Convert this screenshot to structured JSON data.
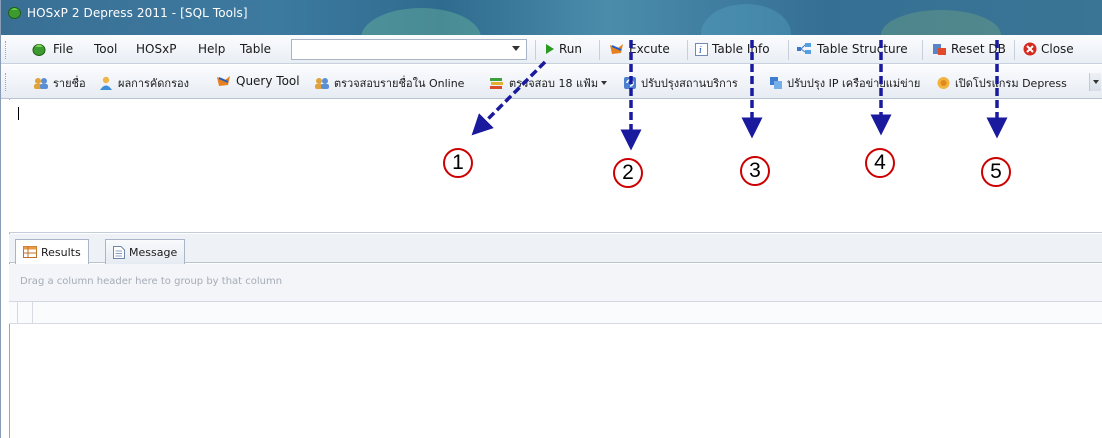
{
  "window": {
    "title": "HOSxP 2 Depress 2011 - [SQL Tools]"
  },
  "menu": {
    "items": [
      "File",
      "Tool",
      "HOSxP",
      "Help",
      "Table"
    ],
    "query_combo_value": "",
    "run": "Run",
    "excute": "Excute",
    "table_info": "Table Info",
    "table_structure": "Table Structure",
    "reset_db": "Reset DB",
    "close": "Close"
  },
  "shortcuts": {
    "items": [
      "รายชื่อ",
      "ผลการคัดกรอง",
      "Query Tool",
      "ตรวจสอบรายชื่อใน Online",
      "ตรวจสอบ 18 แฟ้ม",
      "ปรับปรุงสถานบริการ",
      "ปรับปรุง IP เครือข่ายแม่ข่าย",
      "เปิดโปรแกรม Depress"
    ]
  },
  "tabs": {
    "results": "Results",
    "message": "Message"
  },
  "grid": {
    "group_hint": "Drag a column header here to group by that column"
  },
  "annotations": {
    "labels": [
      "1",
      "2",
      "3",
      "4",
      "5"
    ],
    "arrow_color": "#1a1a9e",
    "circle_color": "#cc0000"
  },
  "colors": {
    "titlebar": "#3a6f94",
    "toolbar": "#e9eef5"
  }
}
